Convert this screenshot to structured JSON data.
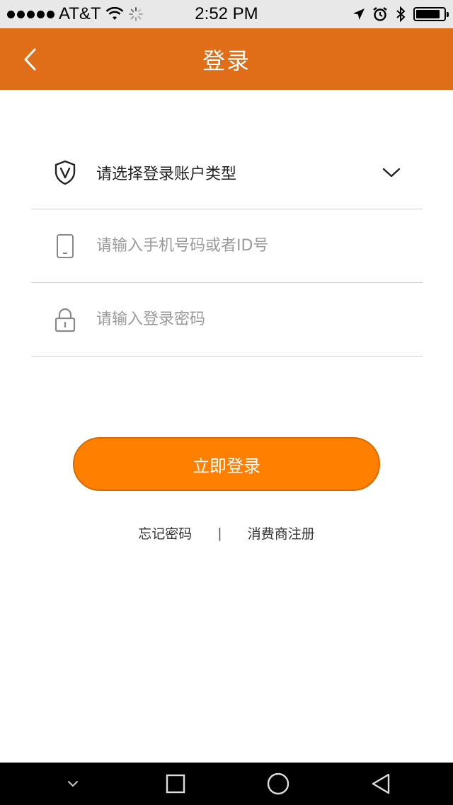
{
  "status_bar": {
    "carrier": "AT&T",
    "time": "2:52 PM"
  },
  "header": {
    "title": "登录"
  },
  "form": {
    "account_type_label": "请选择登录账户类型",
    "phone_placeholder": "请输入手机号码或者ID号",
    "password_placeholder": "请输入登录密码"
  },
  "login_button_label": "立即登录",
  "links": {
    "forgot_password": "忘记密码",
    "separator": "|",
    "register": "消费商注册"
  },
  "colors": {
    "nav_bar": "#e06d18",
    "button": "#ff7f00"
  },
  "icons": {
    "account_type": "shield-v-icon",
    "phone": "phone-icon",
    "password": "lock-icon"
  }
}
